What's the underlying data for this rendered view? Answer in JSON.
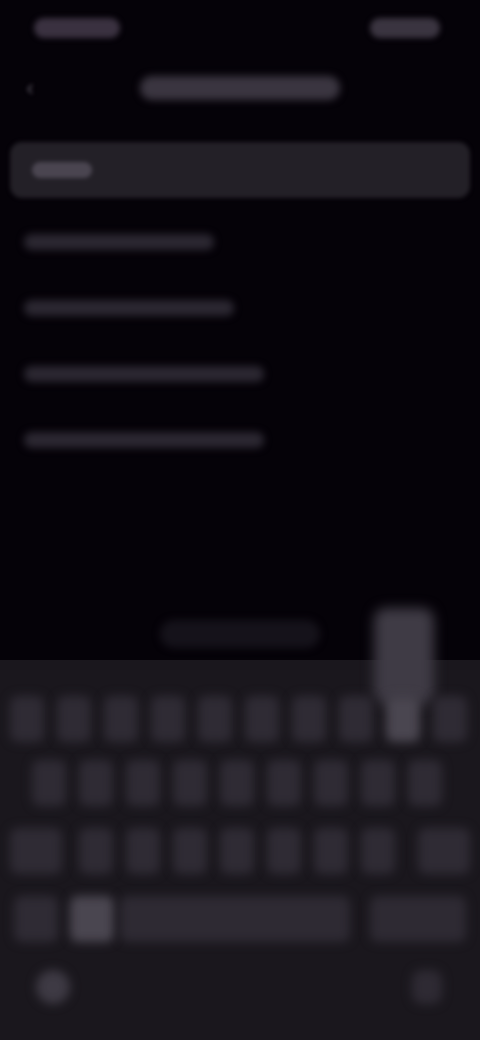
{
  "nav": {
    "back_icon": "back-arrow-icon"
  },
  "search": {
    "value": ""
  },
  "suggestions": [],
  "keyboard": {
    "rows": 3,
    "icons": [
      "globe-icon",
      "microphone-icon",
      "shift-icon",
      "backspace-icon"
    ]
  }
}
